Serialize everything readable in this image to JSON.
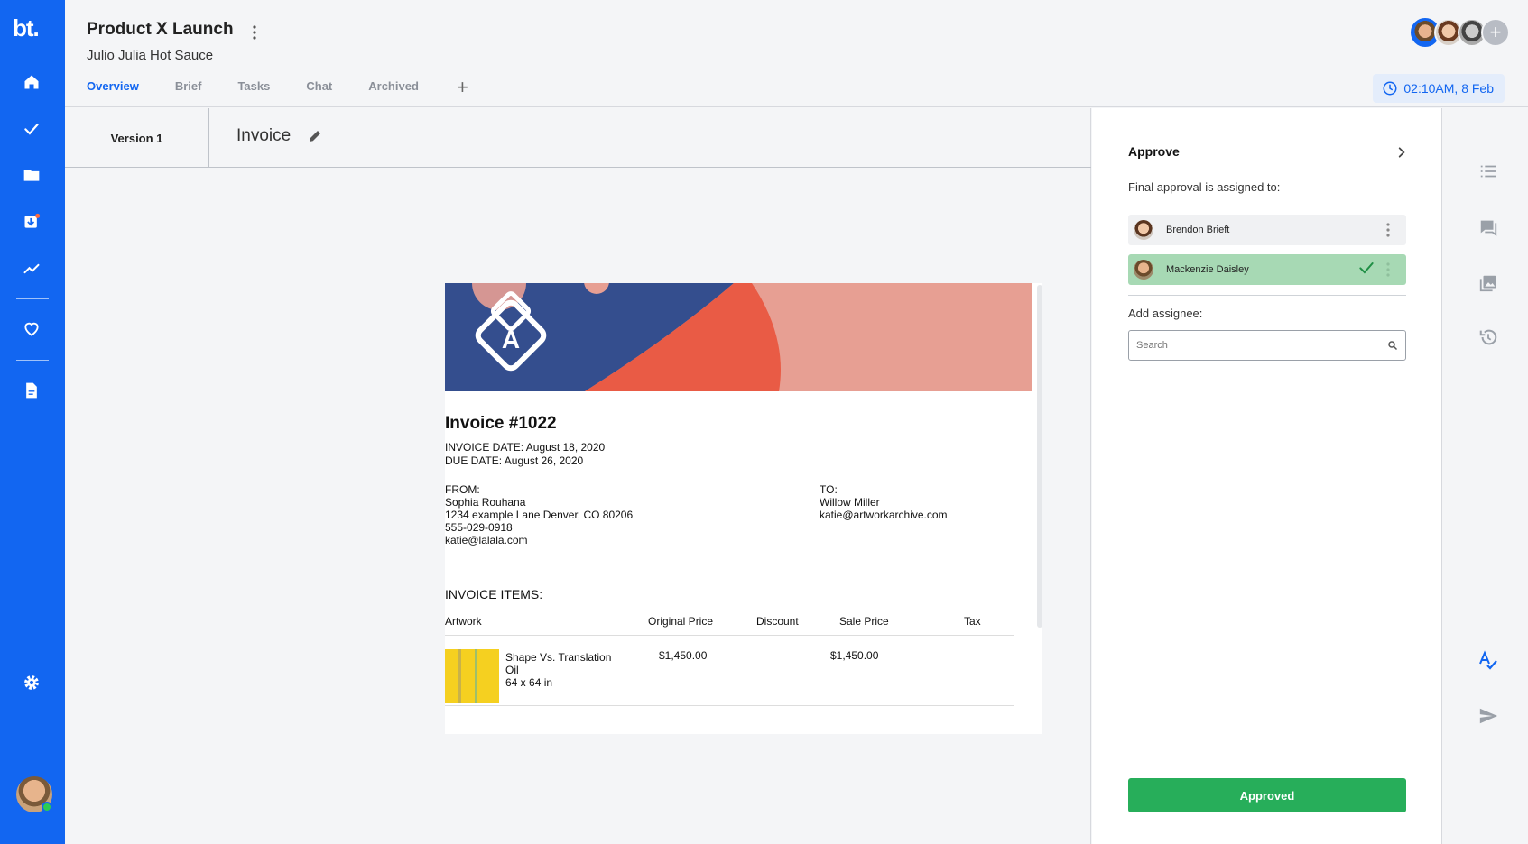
{
  "sidebar": {
    "logo": "bt.",
    "items": [
      {
        "name": "home-icon"
      },
      {
        "name": "check-icon"
      },
      {
        "name": "folder-icon"
      },
      {
        "name": "inbox-icon"
      },
      {
        "name": "trending-icon"
      },
      {
        "name": "heart-icon"
      },
      {
        "name": "document-icon"
      },
      {
        "name": "gear-icon"
      }
    ]
  },
  "header": {
    "title": "Product X Launch",
    "subtitle": "Julio Julia Hot Sauce",
    "tabs": [
      {
        "label": "Overview",
        "active": true
      },
      {
        "label": "Brief"
      },
      {
        "label": "Tasks"
      },
      {
        "label": "Chat"
      },
      {
        "label": "Archived"
      }
    ],
    "add_tab": "+",
    "time": "02:10AM, 8 Feb",
    "add_member": "+"
  },
  "document": {
    "version": "Version 1",
    "title": "Invoice"
  },
  "invoice": {
    "number": "Invoice #1022",
    "invoice_date": "INVOICE DATE: August 18, 2020",
    "due_date": "DUE DATE: August 26, 2020",
    "from_label": "FROM:",
    "from_name": "Sophia Rouhana",
    "from_address": "1234 example Lane Denver, CO 80206",
    "from_phone": "555-029-0918",
    "from_email": "katie@lalala.com",
    "to_label": "TO:",
    "to_name": "Willow Miller",
    "to_email": "katie@artworkarchive.com",
    "items_heading": "INVOICE ITEMS:",
    "columns": [
      "Artwork",
      "Original Price",
      "Discount",
      "Sale Price",
      "Tax"
    ],
    "item": {
      "title": "Shape Vs. Translation",
      "medium": "Oil",
      "size": "64 x 64 in",
      "original_price": "$1,450.00",
      "sale_price": "$1,450.00"
    },
    "logo_letter": "A"
  },
  "approve": {
    "title": "Approve",
    "assigned_label": "Final approval is assigned to:",
    "assignees": [
      {
        "name": "Brendon Brieft",
        "approved": false
      },
      {
        "name": "Mackenzie Daisley",
        "approved": true
      }
    ],
    "add_label": "Add assignee:",
    "search_placeholder": "Search",
    "button_label": "Approved"
  },
  "colors": {
    "primary": "#1266f1",
    "approved_green": "#27ae5a",
    "approved_row": "#a7d9b4"
  }
}
